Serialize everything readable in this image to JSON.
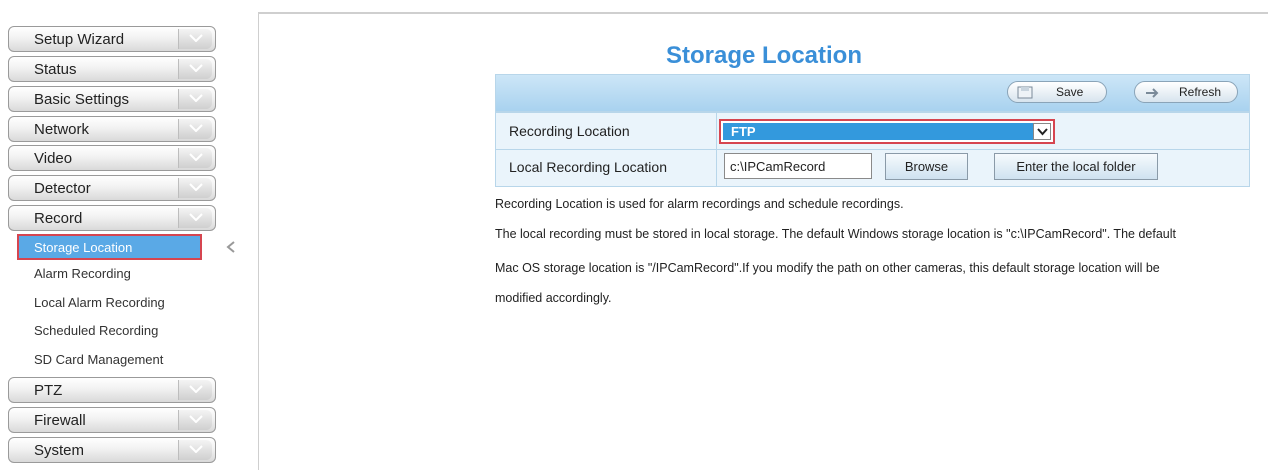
{
  "sidebar": {
    "menu": [
      {
        "label": "Setup Wizard"
      },
      {
        "label": "Status"
      },
      {
        "label": "Basic Settings"
      },
      {
        "label": "Network"
      },
      {
        "label": "Video"
      },
      {
        "label": "Detector"
      },
      {
        "label": "Record"
      }
    ],
    "record_submenu": [
      {
        "label": "Storage Location",
        "active": true
      },
      {
        "label": "Alarm Recording"
      },
      {
        "label": "Local Alarm Recording"
      },
      {
        "label": "Scheduled Recording"
      },
      {
        "label": "SD Card Management"
      }
    ],
    "menu_bottom": [
      {
        "label": "PTZ"
      },
      {
        "label": "Firewall"
      },
      {
        "label": "System"
      }
    ]
  },
  "main": {
    "title": "Storage Location",
    "toolbar": {
      "save_label": "Save",
      "refresh_label": "Refresh"
    },
    "form": {
      "recording_location_label": "Recording Location",
      "recording_location_value": "FTP",
      "local_recording_location_label": "Local Recording Location",
      "local_recording_location_value": "c:\\IPCamRecord",
      "browse_label": "Browse",
      "enter_folder_label": "Enter the local folder"
    },
    "description": [
      "Recording Location is used for alarm recordings and schedule recordings.",
      "The local recording must be stored in local storage. The default Windows storage location is \"c:\\IPCamRecord\". The default",
      "Mac OS storage location is \"/IPCamRecord\".If you modify the path on other cameras, this default storage location will be",
      "modified accordingly."
    ]
  },
  "colors": {
    "title_blue": "#3a8fd8",
    "active_item": "#5aa9e6",
    "highlight_border": "#d64550",
    "toolbar_blue": "#a9d2ef",
    "select_blue": "#3399dd"
  },
  "icons": {
    "menu_expand": "chevron-down-icon",
    "collapse": "chevron-left-icon",
    "save": "save-icon",
    "refresh": "refresh-icon"
  }
}
